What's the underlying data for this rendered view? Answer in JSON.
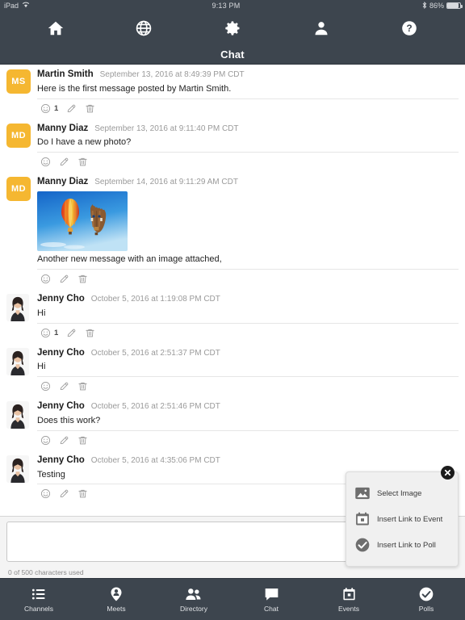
{
  "statusbar": {
    "device": "iPad",
    "wifi_icon": "wifi-icon",
    "time": "9:13 PM",
    "bluetooth_icon": "bluetooth-icon",
    "battery_percent": "86%"
  },
  "topnav": {
    "items": [
      {
        "name": "home-icon",
        "label": "Home"
      },
      {
        "name": "globe-icon",
        "label": "Global"
      },
      {
        "name": "gear-icon",
        "label": "Settings"
      },
      {
        "name": "person-icon",
        "label": "Profile"
      },
      {
        "name": "help-icon",
        "label": "Help"
      }
    ]
  },
  "header": {
    "title": "Chat",
    "background": "#3D454E"
  },
  "messages": [
    {
      "author": "Martin Smith",
      "timestamp": "September 13, 2016 at 8:49:39 PM CDT",
      "text": "Here is the first message posted by Martin Smith.",
      "avatar_type": "initials",
      "avatar_initials": "MS",
      "avatar_color": "#F5B731",
      "reaction_count": "1",
      "has_image": false
    },
    {
      "author": "Manny Diaz",
      "timestamp": "September 13, 2016 at 9:11:40 PM CDT",
      "text": "Do I have a new photo?",
      "avatar_type": "initials",
      "avatar_initials": "MD",
      "avatar_color": "#F5B731",
      "reaction_count": "",
      "has_image": false
    },
    {
      "author": "Manny Diaz",
      "timestamp": "September 14, 2016 at 9:11:29 AM CDT",
      "text": "Another new message with an image attached,",
      "avatar_type": "initials",
      "avatar_initials": "MD",
      "avatar_color": "#F5B731",
      "reaction_count": "",
      "has_image": true,
      "image_alt": "hot-air-balloons-photo"
    },
    {
      "author": "Jenny Cho",
      "timestamp": "October 5, 2016 at 1:19:08 PM CDT",
      "text": "Hi",
      "avatar_type": "photo",
      "avatar_initials": "",
      "avatar_color": "",
      "reaction_count": "1",
      "has_image": false
    },
    {
      "author": "Jenny Cho",
      "timestamp": "October 5, 2016 at 2:51:37 PM CDT",
      "text": "Hi",
      "avatar_type": "photo",
      "avatar_initials": "",
      "avatar_color": "",
      "reaction_count": "",
      "has_image": false
    },
    {
      "author": "Jenny Cho",
      "timestamp": "October 5, 2016 at 2:51:46 PM CDT",
      "text": "Does this work?",
      "avatar_type": "photo",
      "avatar_initials": "",
      "avatar_color": "",
      "reaction_count": "",
      "has_image": false
    },
    {
      "author": "Jenny Cho",
      "timestamp": "October 5, 2016 at 4:35:06 PM CDT",
      "text": "Testing",
      "avatar_type": "photo",
      "avatar_initials": "",
      "avatar_color": "",
      "reaction_count": "",
      "has_image": false
    }
  ],
  "message_actions": {
    "react_icon": "smiley-icon",
    "edit_icon": "pencil-icon",
    "delete_icon": "trash-icon"
  },
  "attach_popup": {
    "close_icon": "close-icon",
    "items": [
      {
        "label": "Select Image",
        "icon": "image-icon"
      },
      {
        "label": "Insert Link to Event",
        "icon": "calendar-icon"
      },
      {
        "label": "Insert Link to Poll",
        "icon": "check-circle-icon"
      }
    ]
  },
  "composer": {
    "value": "",
    "placeholder": "",
    "char_count": "0 of 500 characters used"
  },
  "tabbar": {
    "items": [
      {
        "label": "Channels",
        "icon": "list-icon",
        "active": false
      },
      {
        "label": "Meets",
        "icon": "map-pin-person-icon",
        "active": false
      },
      {
        "label": "Directory",
        "icon": "people-icon",
        "active": false
      },
      {
        "label": "Chat",
        "icon": "speech-bubble-icon",
        "active": true
      },
      {
        "label": "Events",
        "icon": "calendar-icon",
        "active": false
      },
      {
        "label": "Polls",
        "icon": "check-circle-icon",
        "active": false
      }
    ]
  }
}
